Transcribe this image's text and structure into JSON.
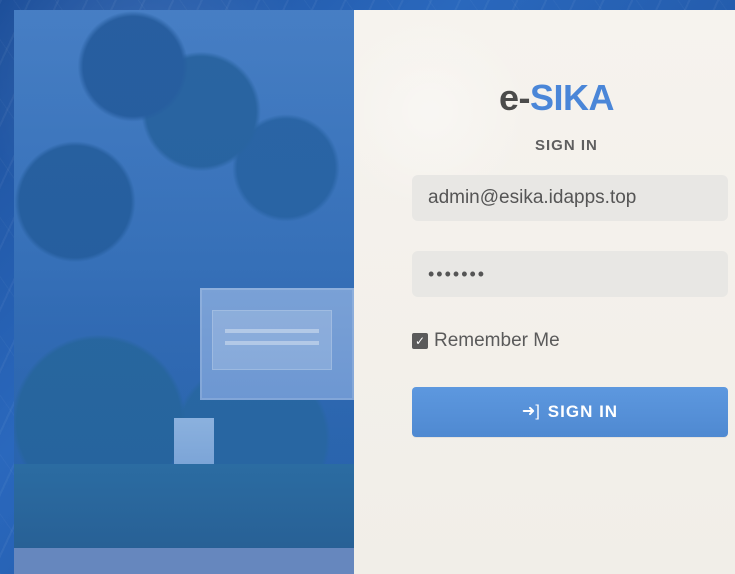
{
  "app": {
    "brand_prefix": "e-",
    "brand_suffix": "SIKA",
    "subtitle": "SIGN IN"
  },
  "form": {
    "email_value": "admin@esika.idapps.top",
    "password_masked": "•••••••",
    "remember_label": "Remember Me",
    "remember_checked": true,
    "submit_label": "SIGN IN",
    "submit_icon": "sign-in-icon"
  },
  "colors": {
    "accent": "#4a86d8",
    "text": "#4b4b4b",
    "input_bg": "#e8e7e4"
  }
}
